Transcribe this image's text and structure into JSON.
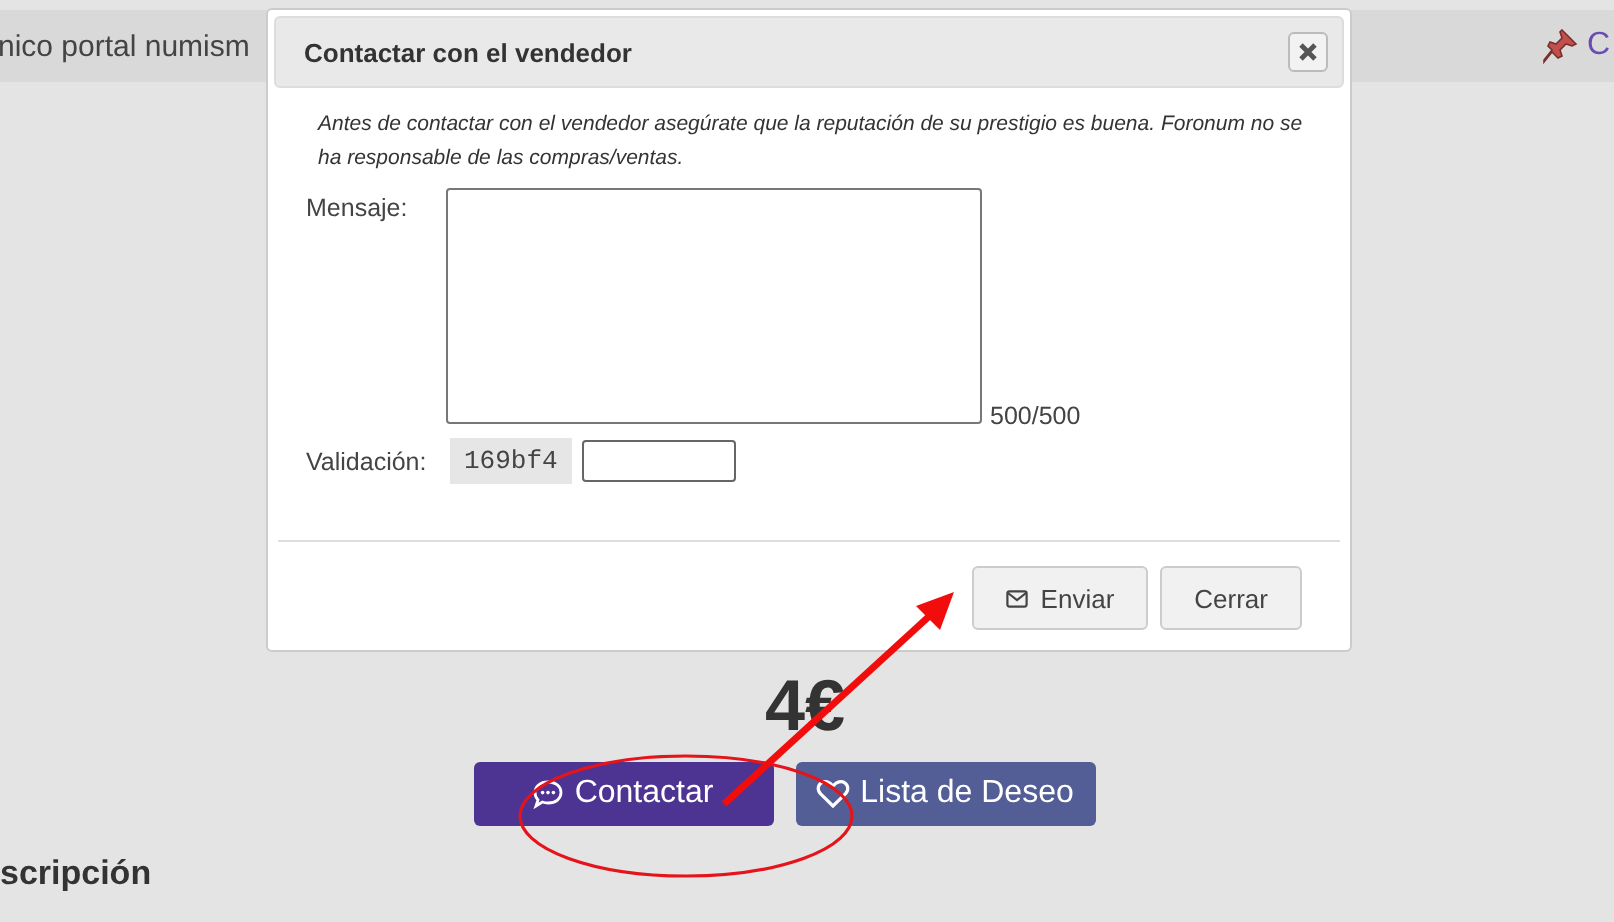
{
  "page": {
    "header_text": "nico portal numism",
    "header_link": "C",
    "price": "4€",
    "buttons": [
      {
        "label": "Contactar",
        "kind": "contact"
      },
      {
        "label": "Lista de Deseo",
        "kind": "wishlist"
      }
    ],
    "section_heading": "scripción"
  },
  "dialog": {
    "title": "Contactar con el vendedor",
    "notice": "Antes de contactar con el vendedor asegúrate que la reputación de su prestigio es buena. Foronum no se ha responsable de las compras/ventas.",
    "message_label": "Mensaje:",
    "counter": "500/500",
    "validation_label": "Validación:",
    "captcha": "169bf4",
    "buttons": [
      {
        "label": "Enviar",
        "kind": "send"
      },
      {
        "label": "Cerrar",
        "kind": "close"
      }
    ]
  }
}
